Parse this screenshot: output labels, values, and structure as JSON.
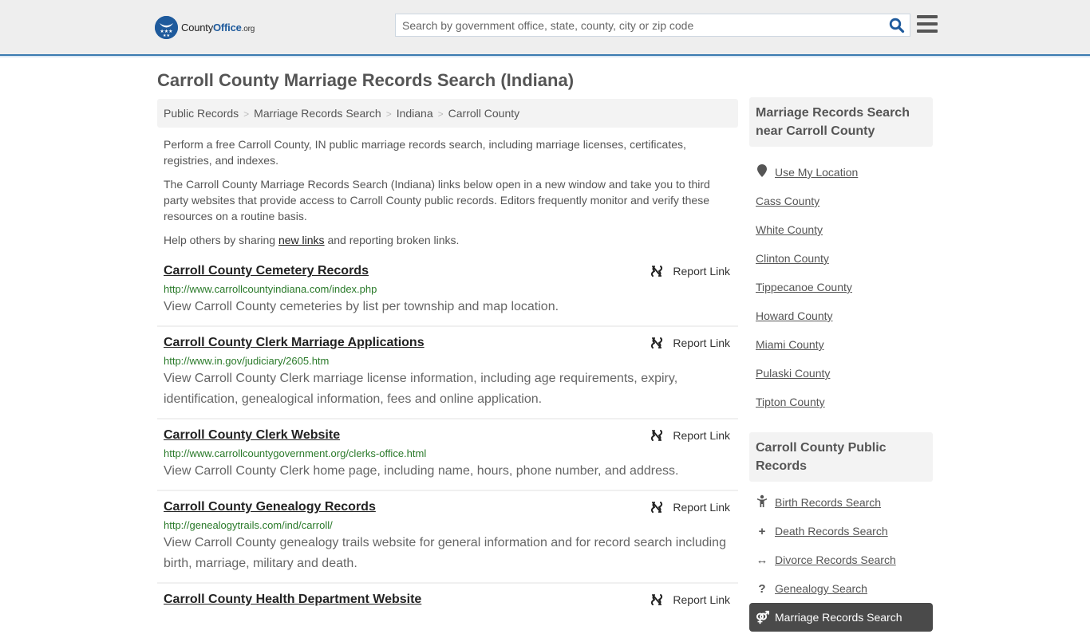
{
  "header": {
    "logo_name": "County",
    "logo_office": "Office",
    "logo_tld": ".org",
    "search_placeholder": "Search by government office, state, county, city or zip code",
    "brand_color": "#1e5a9c",
    "accent_border": "#3b7bb0"
  },
  "page": {
    "title": "Carroll County Marriage Records Search (Indiana)"
  },
  "breadcrumb": [
    {
      "label": "Public Records"
    },
    {
      "label": "Marriage Records Search"
    },
    {
      "label": "Indiana"
    },
    {
      "label": "Carroll County"
    }
  ],
  "intro": {
    "p1": "Perform a free Carroll County, IN public marriage records search, including marriage licenses, certificates, registries, and indexes.",
    "p2": "The Carroll County Marriage Records Search (Indiana) links below open in a new window and take you to third party websites that provide access to Carroll County public records. Editors frequently monitor and verify these resources on a routine basis.",
    "p3_before": "Help others by sharing ",
    "p3_link": "new links",
    "p3_after": " and reporting broken links."
  },
  "report_label": "Report Link",
  "results": [
    {
      "title": "Carroll County Cemetery Records",
      "url": "http://www.carrollcountyindiana.com/index.php",
      "desc": "View Carroll County cemeteries by list per township and map location."
    },
    {
      "title": "Carroll County Clerk Marriage Applications",
      "url": "http://www.in.gov/judiciary/2605.htm",
      "desc": "View Carroll County Clerk marriage license information, including age requirements, expiry, identification, genealogical information, fees and online application."
    },
    {
      "title": "Carroll County Clerk Website",
      "url": "http://www.carrollcountygovernment.org/clerks-office.html",
      "desc": "View Carroll County Clerk home page, including name, hours, phone number, and address."
    },
    {
      "title": "Carroll County Genealogy Records",
      "url": "http://genealogytrails.com/ind/carroll/",
      "desc": "View Carroll County genealogy trails website for general information and for record search including birth, marriage, military and death."
    },
    {
      "title": "Carroll County Health Department Website",
      "url": "",
      "desc": ""
    }
  ],
  "sidebar": {
    "nearby": {
      "heading": "Marriage Records Search near Carroll County",
      "use_location": "Use My Location",
      "counties": [
        "Cass County",
        "White County",
        "Clinton County",
        "Tippecanoe County",
        "Howard County",
        "Miami County",
        "Pulaski County",
        "Tipton County"
      ]
    },
    "public_records": {
      "heading": "Carroll County Public Records",
      "items": [
        {
          "label": "Birth Records Search",
          "icon": "child-icon"
        },
        {
          "label": "Death Records Search",
          "icon": "cross-icon"
        },
        {
          "label": "Divorce Records Search",
          "icon": "arrows-horizontal-icon"
        },
        {
          "label": "Genealogy Search",
          "icon": "question-icon"
        },
        {
          "label": "Marriage Records Search",
          "icon": "marriage-icon",
          "active": true
        }
      ]
    }
  }
}
